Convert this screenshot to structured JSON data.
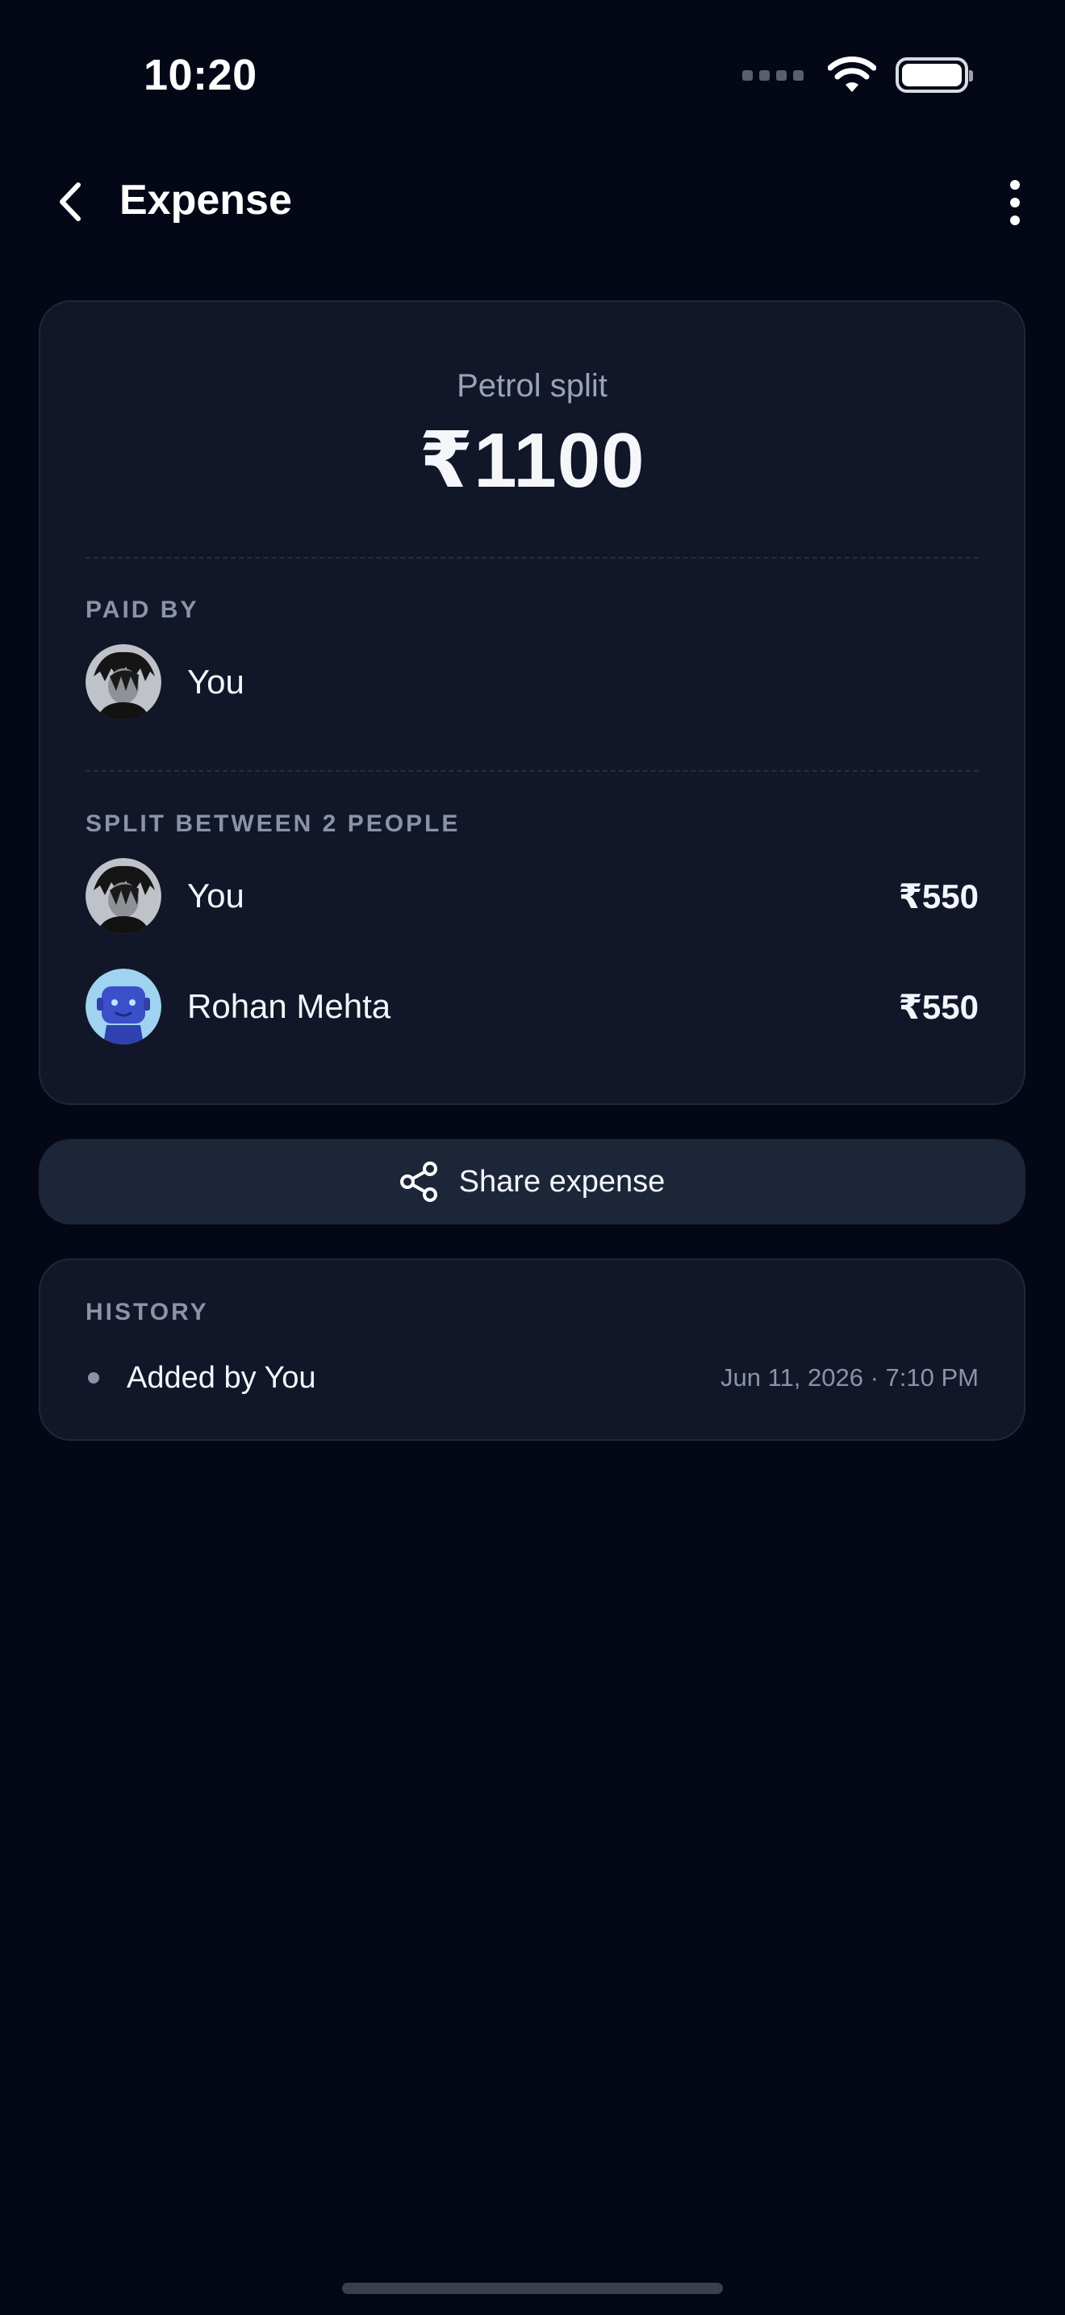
{
  "status_bar": {
    "time": "10:20",
    "signal_icon": "cellular-dots",
    "wifi_icon": "wifi",
    "battery_icon": "battery-full"
  },
  "header": {
    "title": "Expense",
    "back_icon": "chevron-left",
    "more_icon": "vertical-ellipsis"
  },
  "expense": {
    "title": "Petrol split",
    "amount": "₹1100"
  },
  "paid_by": {
    "label": "PAID BY",
    "name": "You"
  },
  "split": {
    "label": "SPLIT BETWEEN 2 PEOPLE",
    "people": [
      {
        "name": "You",
        "amount": "₹550"
      },
      {
        "name": "Rohan Mehta",
        "amount": "₹550"
      }
    ]
  },
  "share": {
    "label": "Share expense",
    "icon": "share-nodes"
  },
  "history": {
    "label": "HISTORY",
    "entries": [
      {
        "text": "Added by You",
        "time": "Jun 11, 2026 · 7:10 PM"
      }
    ]
  },
  "colors": {
    "background": "#040816",
    "card": "#111729",
    "button": "#1d2638",
    "muted_text": "#8a93a8"
  }
}
